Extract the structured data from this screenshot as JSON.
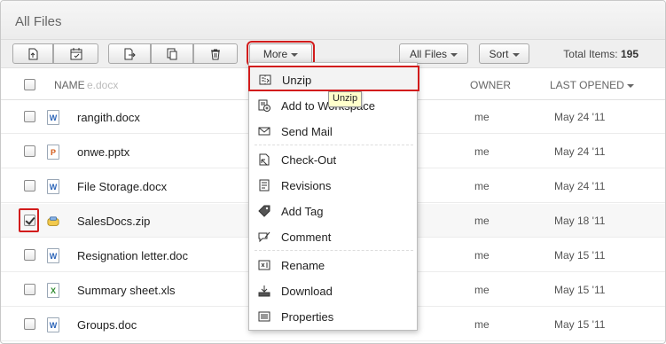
{
  "header": {
    "title": "All Files"
  },
  "toolbar": {
    "more_label": "More",
    "all_files_label": "All Files",
    "sort_label": "Sort",
    "total_label": "Total Items:",
    "total_count": "195"
  },
  "columns": {
    "name": "NAME",
    "name_ghost": "e.docx",
    "owner": "OWNER",
    "last_opened": "LAST OPENED"
  },
  "files": [
    {
      "name": "rangith.docx",
      "type": "word",
      "owner": "me",
      "date": "May 24 '11",
      "checked": false
    },
    {
      "name": "onwe.pptx",
      "type": "ppt",
      "owner": "me",
      "date": "May 24 '11",
      "checked": false
    },
    {
      "name": "File Storage.docx",
      "type": "word",
      "owner": "me",
      "date": "May 24 '11",
      "checked": false
    },
    {
      "name": "SalesDocs.zip",
      "type": "zip",
      "owner": "me",
      "date": "May 18 '11",
      "checked": true
    },
    {
      "name": "Resignation letter.doc",
      "type": "word",
      "owner": "me",
      "date": "May 15 '11",
      "checked": false
    },
    {
      "name": "Summary sheet.xls",
      "type": "xls",
      "owner": "me",
      "date": "May 15 '11",
      "checked": false
    },
    {
      "name": "Groups.doc",
      "type": "word",
      "owner": "me",
      "date": "May 15 '11",
      "checked": false
    }
  ],
  "menu": {
    "items": [
      {
        "label": "Unzip",
        "icon": "unzip-icon"
      },
      {
        "label": "Add to Workspace",
        "icon": "add-to-workspace-icon"
      },
      {
        "label": "Send Mail",
        "icon": "mail-icon"
      },
      {
        "label": "Check-Out",
        "icon": "check-out-icon"
      },
      {
        "label": "Revisions",
        "icon": "revisions-icon"
      },
      {
        "label": "Add Tag",
        "icon": "tag-icon"
      },
      {
        "label": "Comment",
        "icon": "comment-icon"
      },
      {
        "label": "Rename",
        "icon": "rename-icon"
      },
      {
        "label": "Download",
        "icon": "download-icon"
      },
      {
        "label": "Properties",
        "icon": "properties-icon"
      }
    ]
  },
  "tooltip": {
    "text": "Unzip"
  },
  "icon_glyphs": {
    "word": "W",
    "ppt": "P",
    "xls": "X"
  },
  "colors": {
    "highlight_red": "#d21c1c",
    "tooltip_bg": "#ffffcc",
    "word_blue": "#2b64b8",
    "ppt_orange": "#d35a18",
    "xls_green": "#2e8b2e"
  }
}
